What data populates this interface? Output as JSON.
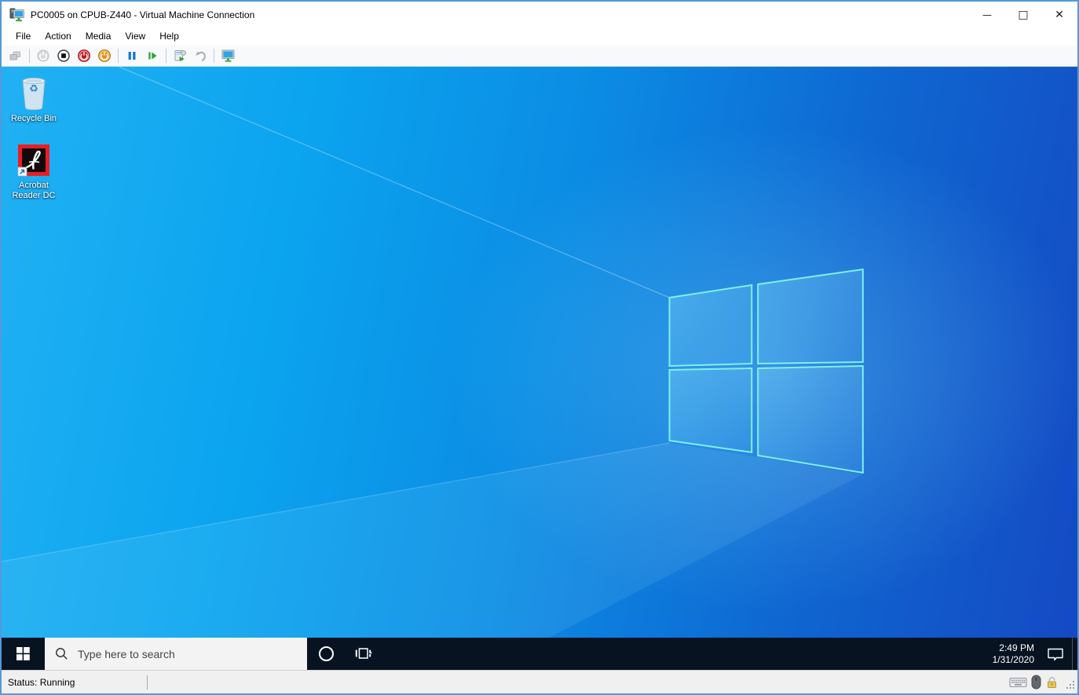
{
  "window": {
    "title": "PC0005 on CPUB-Z440 - Virtual Machine Connection",
    "icon": "vm-connection-icon",
    "controls": {
      "minimize": "—",
      "maximize": "□",
      "close": "✕"
    }
  },
  "menu": {
    "items": [
      {
        "label": "File"
      },
      {
        "label": "Action"
      },
      {
        "label": "Media"
      },
      {
        "label": "View"
      },
      {
        "label": "Help"
      }
    ]
  },
  "toolbar": {
    "buttons": [
      {
        "name": "ctrl-alt-delete",
        "enabled": false
      },
      {
        "name": "start",
        "enabled": false
      },
      {
        "name": "turn-off",
        "enabled": true
      },
      {
        "name": "shut-down",
        "enabled": true
      },
      {
        "name": "save",
        "enabled": true
      },
      {
        "name": "pause",
        "enabled": true
      },
      {
        "name": "reset",
        "enabled": true
      },
      {
        "name": "checkpoint",
        "enabled": true
      },
      {
        "name": "revert",
        "enabled": false
      },
      {
        "name": "enhanced-session",
        "enabled": true
      }
    ]
  },
  "desktop": {
    "icons": [
      {
        "label": "Recycle Bin",
        "icon": "recycle-bin-icon"
      },
      {
        "label": "Acrobat Reader DC",
        "icon": "acrobat-reader-icon"
      }
    ]
  },
  "taskbar": {
    "search": {
      "placeholder": "Type here to search"
    },
    "clock": {
      "time": "2:49 PM",
      "date": "1/31/2020"
    },
    "icons": [
      "start-icon",
      "search-icon",
      "cortana-icon",
      "task-view-icon",
      "action-center-icon"
    ]
  },
  "status_bar": {
    "status": "Status: Running",
    "icons": [
      "keyboard-icon",
      "mouse-icon",
      "unlock-icon",
      "resize-grip"
    ]
  },
  "colors": {
    "window_border": "#5598da",
    "taskbar_bg": "#071321",
    "wallpaper_light": "#21b1f3",
    "wallpaper_dark": "#1549c3",
    "logo_edge": "#7ef0ee"
  }
}
